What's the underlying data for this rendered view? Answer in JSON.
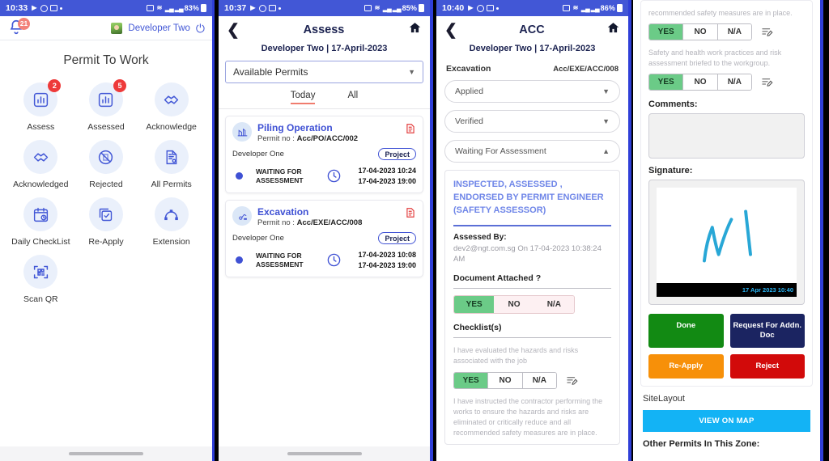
{
  "panel1": {
    "status": {
      "time": "10:33",
      "battery": "83%",
      "icons": [
        "video-icon",
        "x-circle-icon",
        "image-icon",
        "dot-icon"
      ],
      "right_icons": [
        "camera-icon",
        "wifi-icon",
        "signal-icon",
        "signal-icon"
      ]
    },
    "notification_badge": "21",
    "user_name": "Developer Two",
    "title": "Permit To Work",
    "tiles": [
      {
        "label": "Assess",
        "icon": "chart-bar-icon",
        "badge": "2"
      },
      {
        "label": "Assessed",
        "icon": "chart-bar-icon",
        "badge": "5"
      },
      {
        "label": "Acknowledge",
        "icon": "handshake-icon",
        "badge": ""
      },
      {
        "label": "Acknowledged",
        "icon": "handshake-icon",
        "badge": ""
      },
      {
        "label": "Rejected",
        "icon": "no-document-icon",
        "badge": ""
      },
      {
        "label": "All Permits",
        "icon": "certificate-icon",
        "badge": ""
      },
      {
        "label": "Daily CheckList",
        "icon": "calendar-clock-icon",
        "badge": ""
      },
      {
        "label": "Re-Apply",
        "icon": "copy-check-icon",
        "badge": ""
      },
      {
        "label": "Extension",
        "icon": "node-graph-icon",
        "badge": ""
      },
      {
        "label": "Scan QR",
        "icon": "qr-scan-icon",
        "badge": ""
      }
    ]
  },
  "panel2": {
    "status": {
      "time": "10:37",
      "battery": "85%"
    },
    "title": "Assess",
    "subtitle": "Developer Two | 17-April-2023",
    "dropdown": "Available Permits",
    "tabs": [
      {
        "label": "Today",
        "active": true
      },
      {
        "label": "All",
        "active": false
      }
    ],
    "cards": [
      {
        "title": "Piling Operation",
        "permit_label": "Permit no :",
        "permit_no": "Acc/PO/ACC/002",
        "developer": "Developer One",
        "chip": "Project",
        "status": "WAITING FOR ASSESSMENT",
        "time_start": "17-04-2023 10:24",
        "time_end": "17-04-2023 19:00",
        "icon": "piling-rig-icon"
      },
      {
        "title": "Excavation",
        "permit_label": "Permit no :",
        "permit_no": "Acc/EXE/ACC/008",
        "developer": "Developer One",
        "chip": "Project",
        "status": "WAITING FOR ASSESSMENT",
        "time_start": "17-04-2023 10:08",
        "time_end": "17-04-2023 19:00",
        "icon": "excavator-icon"
      }
    ]
  },
  "panel3": {
    "status": {
      "time": "10:40",
      "battery": "86%"
    },
    "title": "ACC",
    "subtitle": "Developer Two | 17-April-2023",
    "permit_type": "Excavation",
    "permit_no": "Acc/EXE/ACC/008",
    "sections": [
      {
        "label": "Applied",
        "state": "collapsed"
      },
      {
        "label": "Verified",
        "state": "collapsed"
      },
      {
        "label": "Waiting For Assessment",
        "state": "expanded"
      }
    ],
    "card_heading": "INSPECTED, ASSESSED , ENDORSED BY PERMIT ENGINEER (SAFETY ASSESSOR)",
    "assessed_by_label": "Assessed By:",
    "assessed_by_value": "dev2@ngt.com.sg On 17-04-2023 10:38:24 AM",
    "document_attached_label": "Document Attached ?",
    "doc_options": [
      "YES",
      "NO",
      "N/A"
    ],
    "doc_selected": "YES",
    "checklist_label": "Checklist(s)",
    "checklist": [
      {
        "question": "I have evaluated the hazards and risks associated with the job",
        "options": [
          "YES",
          "NO",
          "N/A"
        ],
        "selected": "YES"
      },
      {
        "question": "I have instructed the contractor performing the works to ensure the hazards and risks are eliminated or critically reduce and all recommended safety measures are in place.",
        "options": [
          "YES",
          "NO",
          "N/A"
        ],
        "selected": "YES"
      }
    ]
  },
  "panel4": {
    "checklist": [
      {
        "question": "recommended safety measures are in place.",
        "options": [
          "YES",
          "NO",
          "N/A"
        ],
        "selected": "YES"
      },
      {
        "question": "Safety and health work practices and risk assessment briefed to the workgroup.",
        "options": [
          "YES",
          "NO",
          "N/A"
        ],
        "selected": "YES"
      }
    ],
    "comments_label": "Comments:",
    "comments_value": "",
    "signature_label": "Signature:",
    "signature_stamp": "17 Apr 2023 10:40",
    "buttons": [
      {
        "label": "Done",
        "color": "#128a13"
      },
      {
        "label": "Request For Addn. Doc",
        "color": "#1b2461"
      },
      {
        "label": "Re-Apply",
        "color": "#f79009"
      },
      {
        "label": "Reject",
        "color": "#d20a0a"
      }
    ],
    "site_layout_label": "SiteLayout",
    "view_on_map": "VIEW ON MAP",
    "other_permits_label": "Other Permits In This Zone:"
  }
}
